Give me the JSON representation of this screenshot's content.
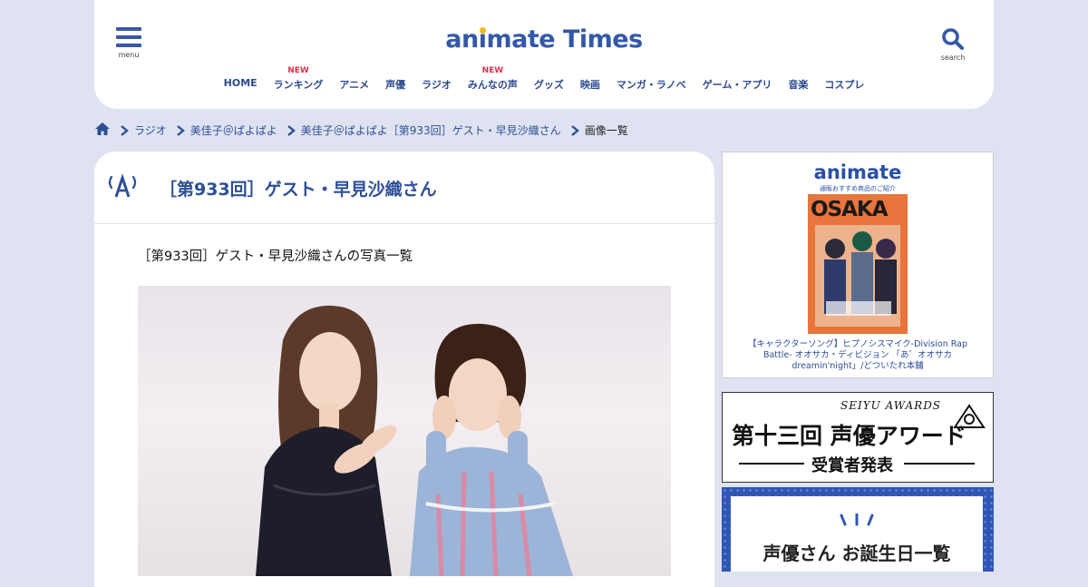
{
  "header": {
    "logo": "animate Times",
    "menu_label": "menu",
    "search_label": "search",
    "nav": [
      {
        "label": "HOME",
        "badge": ""
      },
      {
        "label": "ランキング",
        "badge": "NEW"
      },
      {
        "label": "アニメ",
        "badge": ""
      },
      {
        "label": "声優",
        "badge": ""
      },
      {
        "label": "ラジオ",
        "badge": ""
      },
      {
        "label": "みんなの声",
        "badge": "NEW"
      },
      {
        "label": "グッズ",
        "badge": ""
      },
      {
        "label": "映画",
        "badge": ""
      },
      {
        "label": "マンガ・ラノベ",
        "badge": ""
      },
      {
        "label": "ゲーム・アプリ",
        "badge": ""
      },
      {
        "label": "音楽",
        "badge": ""
      },
      {
        "label": "コスプレ",
        "badge": ""
      }
    ]
  },
  "breadcrumb": {
    "items": [
      "ラジオ",
      "美佳子＠ぱよぱよ",
      "美佳子＠ぱよぱよ［第933回］ゲスト・早見沙織さん"
    ],
    "current": "画像一覧"
  },
  "main": {
    "title": "［第933回］ゲスト・早見沙織さん",
    "subtitle": "［第933回］ゲスト・早見沙織さんの写真一覧"
  },
  "sidebar": {
    "ad1": {
      "brand": "animate",
      "brand_sub": "通販おすすめ商品のご紹介",
      "cover_text": "OSAKA",
      "caption": "【キャラクターソング】ヒプノシスマイク-Division Rap Battle- オオサカ・ディビジョン 「あ゛オオサカdreamin'night」/どついたれ本舗"
    },
    "ad2": {
      "eng": "SEIYU AWARDS",
      "title": "第十三回 声優アワード",
      "sub": "受賞者発表"
    },
    "ad3": {
      "title": "声優さん お誕生日一覧"
    }
  },
  "colors": {
    "brand_blue": "#3458a7",
    "new_badge": "#e2314b",
    "page_bg": "#dfe3f1"
  }
}
